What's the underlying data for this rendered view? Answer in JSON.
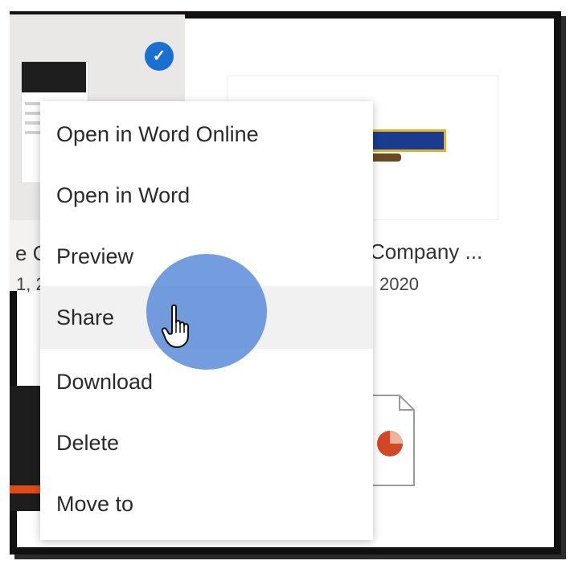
{
  "context_menu": {
    "items": [
      {
        "label": "Open in Word Online"
      },
      {
        "label": "Open in Word"
      },
      {
        "label": "Preview"
      },
      {
        "label": "Share"
      },
      {
        "label": "Download"
      },
      {
        "label": "Delete"
      },
      {
        "label": "Move to"
      }
    ],
    "hovered_index": 3
  },
  "files": {
    "right_card": {
      "name": "Company ...",
      "date": "2020"
    },
    "left_card": {
      "name_fragment": "e C",
      "date_fragment": "1, 2",
      "selected": true
    }
  },
  "icons": {
    "selected_check": "check-circle-icon",
    "cursor": "hand-pointer-icon",
    "powerpoint_file": "powerpoint-file-icon"
  },
  "colors": {
    "check_badge": "#1a6fd0",
    "cursor_halo": "#5c8cda",
    "menu_hover": "#f1f1f1",
    "powerpoint_accent": "#d24726"
  }
}
